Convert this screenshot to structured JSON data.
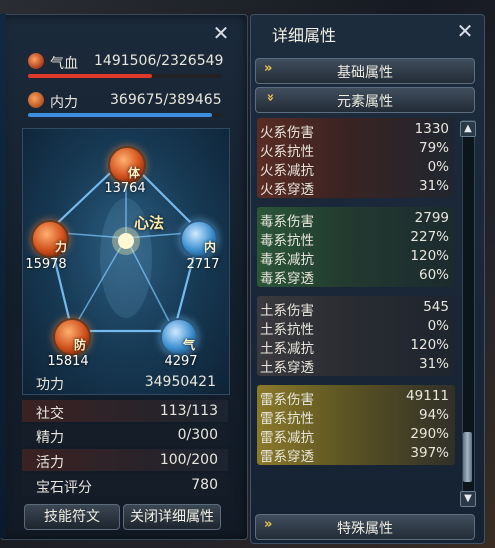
{
  "left_panel": {
    "hp_label": "气血",
    "hp_value": "1491506/2326549",
    "hp_fraction": 0.64,
    "mp_label": "内力",
    "mp_value": "369675/389465",
    "mp_fraction": 0.95,
    "meridian_center": "心法",
    "nodes": {
      "top": {
        "glyph": "体",
        "value": "13764"
      },
      "left": {
        "glyph": "力",
        "value": "15978"
      },
      "right": {
        "glyph": "内",
        "value": "2717"
      },
      "bottom_left": {
        "glyph": "防",
        "value": "15814"
      },
      "bottom_right": {
        "glyph": "气",
        "value": "4297"
      }
    },
    "power_label": "功力",
    "power_value": "34950421",
    "stats": [
      {
        "label": "社交",
        "value": "113/113"
      },
      {
        "label": "精力",
        "value": "0/300"
      },
      {
        "label": "活力",
        "value": "100/200"
      },
      {
        "label": "宝石评分",
        "value": "780"
      }
    ],
    "buttons": {
      "skill": "技能符文",
      "close_detail": "关闭详细属性"
    }
  },
  "right_panel": {
    "title": "详细属性",
    "tabs": {
      "basic": "基础属性",
      "element": "元素属性",
      "special": "特殊属性"
    },
    "groups": [
      {
        "rows": [
          {
            "label": "火系伤害",
            "value": "1330"
          },
          {
            "label": "火系抗性",
            "value": "79%"
          },
          {
            "label": "火系减抗",
            "value": "0%"
          },
          {
            "label": "火系穿透",
            "value": "31%"
          }
        ]
      },
      {
        "rows": [
          {
            "label": "毒系伤害",
            "value": "2799"
          },
          {
            "label": "毒系抗性",
            "value": "227%"
          },
          {
            "label": "毒系减抗",
            "value": "120%"
          },
          {
            "label": "毒系穿透",
            "value": "60%"
          }
        ]
      },
      {
        "rows": [
          {
            "label": "土系伤害",
            "value": "545"
          },
          {
            "label": "土系抗性",
            "value": "0%"
          },
          {
            "label": "土系减抗",
            "value": "120%"
          },
          {
            "label": "土系穿透",
            "value": "31%"
          }
        ]
      },
      {
        "rows": [
          {
            "label": "雷系伤害",
            "value": "49111"
          },
          {
            "label": "雷系抗性",
            "value": "94%"
          },
          {
            "label": "雷系减抗",
            "value": "290%"
          },
          {
            "label": "雷系穿透",
            "value": "397%"
          }
        ]
      }
    ]
  },
  "colors": {
    "hp_bar": "#e0392a",
    "mp_bar": "#3c8fe0",
    "accent": "#f2c44a"
  }
}
